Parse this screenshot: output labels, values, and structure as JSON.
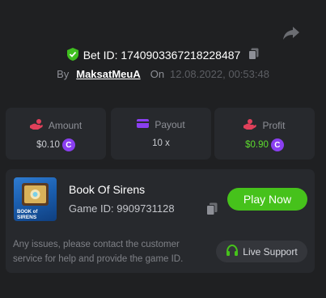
{
  "bet": {
    "label": "Bet ID:",
    "id": "1740903367218228487",
    "by_label": "By",
    "user": "MaksatMeuA",
    "on_label": "On",
    "date": "12.08.2022, 00:53:48"
  },
  "stats": [
    {
      "label": "Amount",
      "value": "$0.10",
      "icon": "hand-coins-icon",
      "icon_color": "#e0405a",
      "value_color": "#c9cbd0"
    },
    {
      "label": "Payout",
      "value": "10 x",
      "icon": "wallet-icon",
      "icon_color": "#8a3ff0",
      "value_color": "#c9cbd0"
    },
    {
      "label": "Profit",
      "value": "$0.90",
      "icon": "hand-coins-icon",
      "icon_color": "#e0405a",
      "value_color": "#5ddc2e"
    }
  ],
  "coin_symbol": "C",
  "game": {
    "title": "Book Of Sirens",
    "id_label": "Game ID:",
    "id": "9909731128",
    "thumb_text_line1": "BOOK of",
    "thumb_text_line2": "SIRENS",
    "play_label": "Play Now"
  },
  "help_text": "Any issues, please contact the customer service for help and provide the game ID.",
  "support_label": "Live Support",
  "colors": {
    "background": "#1f2022",
    "card": "#27292d",
    "accent_green": "#46c21b",
    "coin_purple": "#8a3ff0"
  }
}
